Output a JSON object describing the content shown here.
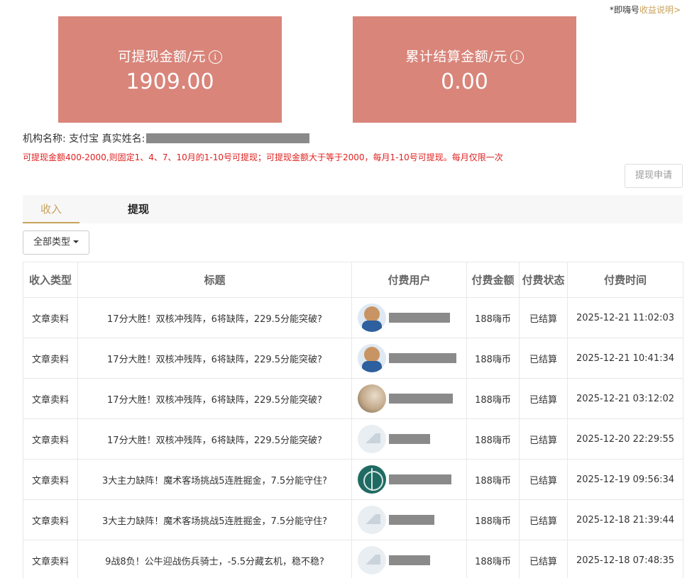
{
  "top_note": {
    "prefix": "*即嗨号",
    "link": "收益说明>"
  },
  "cards": [
    {
      "label": "可提现金额/元",
      "info": "i",
      "value": "1909.00"
    },
    {
      "label": "累计结算金额/元",
      "info": "i",
      "value": "0.00"
    }
  ],
  "org": {
    "text": "机构名称: 支付宝 真实姓名:"
  },
  "warning": "可提现金额400-2000,则固定1、4、7、10月的1-10号可提现；可提现金额大于等于2000，每月1-10号可提现。每月仅限一次",
  "withdraw_button": "提现申请",
  "tabs": [
    "收入",
    "提现"
  ],
  "filter": {
    "label": "全部类型"
  },
  "table": {
    "headers": [
      "收入类型",
      "标题",
      "付费用户",
      "付费金额",
      "付费状态",
      "付费时间"
    ],
    "rows": [
      {
        "type": "文章卖料",
        "title": "17分大胜！双核冲残阵，6将缺阵，229.5分能突破?",
        "avatar": "cartoon-avatar",
        "amount": "188嗨币",
        "status": "已结算",
        "time": "2025-12-21 11:02:03"
      },
      {
        "type": "文章卖料",
        "title": "17分大胜！双核冲残阵，6将缺阵，229.5分能突破?",
        "avatar": "cartoon-avatar",
        "amount": "188嗨币",
        "status": "已结算",
        "time": "2025-12-21 10:41:34"
      },
      {
        "type": "文章卖料",
        "title": "17分大胜！双核冲残阵，6将缺阵，229.5分能突破?",
        "avatar": "cat-avatar",
        "amount": "188嗨币",
        "status": "已结算",
        "time": "2025-12-21 03:12:02"
      },
      {
        "type": "文章卖料",
        "title": "17分大胜！双核冲残阵，6将缺阵，229.5分能突破?",
        "avatar": "default-avatar",
        "amount": "188嗨币",
        "status": "已结算",
        "time": "2025-12-20 22:29:55"
      },
      {
        "type": "文章卖料",
        "title": "3大主力缺阵！魔术客场挑战5连胜掘金，7.5分能守住?",
        "avatar": "pitch-avatar",
        "amount": "188嗨币",
        "status": "已结算",
        "time": "2025-12-19 09:56:34"
      },
      {
        "type": "文章卖料",
        "title": "3大主力缺阵！魔术客场挑战5连胜掘金，7.5分能守住?",
        "avatar": "default-avatar",
        "amount": "188嗨币",
        "status": "已结算",
        "time": "2025-12-18 21:39:44"
      },
      {
        "type": "文章卖料",
        "title": "9战8负！公牛迎战伤兵骑士，-5.5分藏玄机，稳不稳?",
        "avatar": "default-avatar",
        "amount": "188嗨币",
        "status": "已结算",
        "time": "2025-12-18 07:48:35"
      }
    ]
  },
  "colors": {
    "card_bg": "#d9857a",
    "accent": "#c8a25c",
    "warning": "#e02020"
  }
}
